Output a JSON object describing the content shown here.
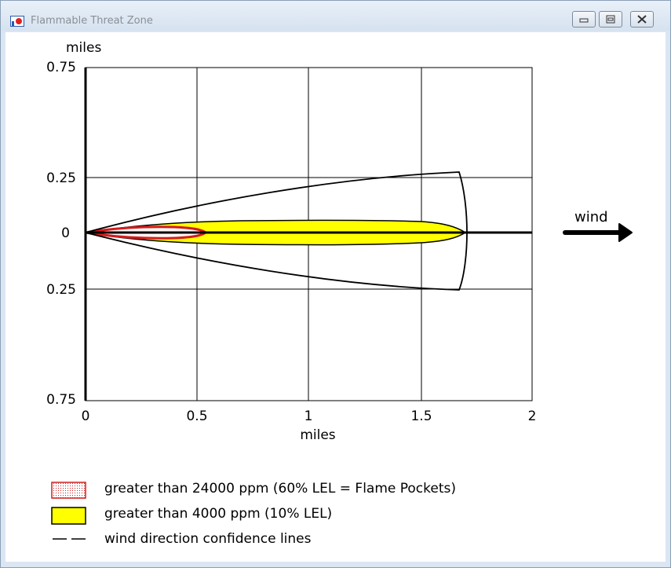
{
  "window": {
    "title": "Flammable Threat Zone",
    "buttons": {
      "minimize": "minimize-icon",
      "maximize": "maximize-icon",
      "close": "close-icon"
    }
  },
  "plot": {
    "y_unit_label": "miles",
    "x_axis_label": "miles",
    "x_ticks": [
      "0",
      "0.5",
      "1",
      "1.5",
      "2"
    ],
    "y_ticks": [
      "0.75",
      "0.25",
      "0",
      "0.25",
      "0.75"
    ],
    "wind_label": "wind",
    "colors": {
      "flame_pockets": "#d41c1c",
      "lel10": "#ffff00",
      "confidence": "#000000",
      "grid": "#000000"
    }
  },
  "legend": [
    {
      "label": "greater than 24000 ppm (60% LEL = Flame Pockets)",
      "swatch": "red-dotted"
    },
    {
      "label": "greater than 4000 ppm (10% LEL)",
      "swatch": "yellow"
    },
    {
      "label": "wind direction confidence lines",
      "swatch": "dashed-line"
    }
  ]
}
